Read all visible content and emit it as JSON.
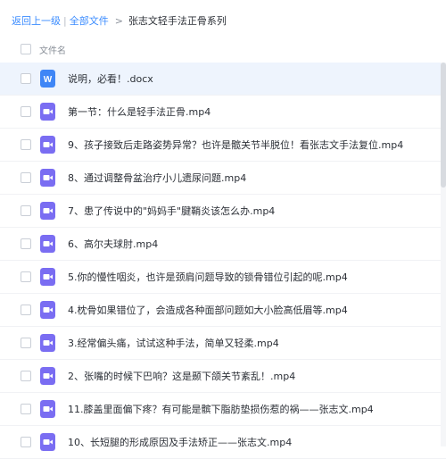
{
  "breadcrumb": {
    "back": "返回上一级",
    "separator": "|",
    "all_files": "全部文件",
    "arrow": ">",
    "current": "张志文轻手法正骨系列"
  },
  "header": {
    "filename_label": "文件名"
  },
  "files": [
    {
      "name": "说明，必看！.docx",
      "icon": "word-doc-icon"
    },
    {
      "name": "第一节：什么是轻手法正骨.mp4",
      "icon": "video-file-icon"
    },
    {
      "name": "9、孩子接致后走路姿势异常？也许是髋关节半脱位！看张志文手法复位.mp4",
      "icon": "video-file-icon"
    },
    {
      "name": "8、通过调整骨盆治疗小儿遗尿问题.mp4",
      "icon": "video-file-icon"
    },
    {
      "name": "7、患了传说中的\"妈妈手\"腱鞘炎该怎么办.mp4",
      "icon": "video-file-icon"
    },
    {
      "name": "6、高尔夫球肘.mp4",
      "icon": "video-file-icon"
    },
    {
      "name": "5.你的慢性咽炎，也许是颈肩问题导致的锁骨错位引起的呢.mp4",
      "icon": "video-file-icon"
    },
    {
      "name": "4.枕骨如果错位了，会造成各种面部问题如大小脸高低眉等.mp4",
      "icon": "video-file-icon"
    },
    {
      "name": "3.经常偏头痛，试试这种手法，简单又轻柔.mp4",
      "icon": "video-file-icon"
    },
    {
      "name": "2、张嘴的时候下巴响？这是颞下颌关节紊乱！.mp4",
      "icon": "video-file-icon"
    },
    {
      "name": "11.膝盖里面偏下疼？有可能是髌下脂肪垫损伤惹的祸——张志文.mp4",
      "icon": "video-file-icon"
    },
    {
      "name": "10、长短腿的形成原因及手法矫正——张志文.mp4",
      "icon": "video-file-icon"
    }
  ],
  "colors": {
    "link": "#3b8cff",
    "word_icon": "#3f86f6",
    "video_icon": "#7a6df2",
    "selected_row": "#eef4fd"
  }
}
